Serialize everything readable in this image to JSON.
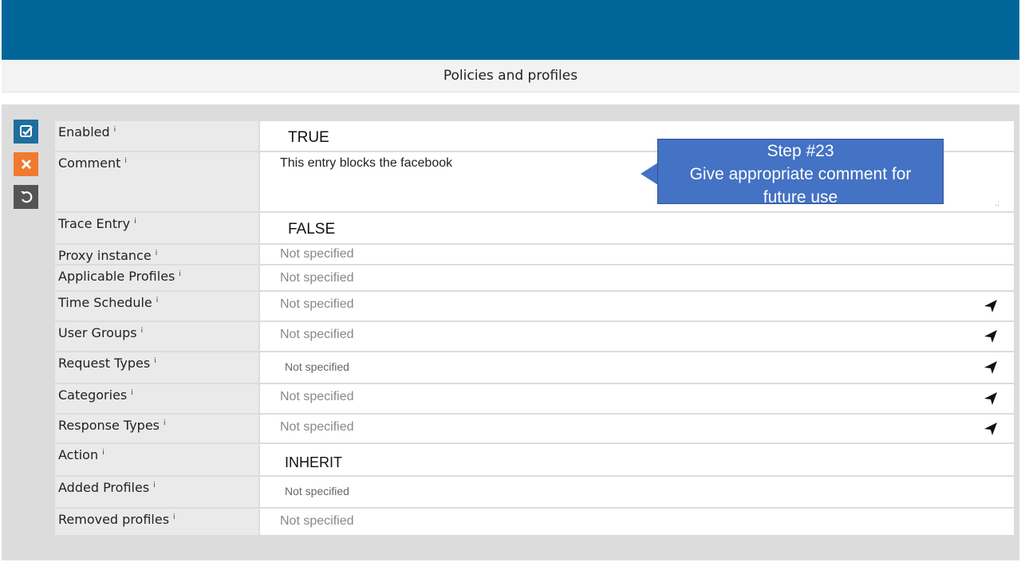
{
  "header": {
    "title": "Policies and profiles"
  },
  "actions": {
    "confirm_icon": "check-square-icon",
    "cancel_icon": "close-icon",
    "revert_icon": "undo-icon"
  },
  "fields": [
    {
      "label": "Enabled",
      "value": "TRUE"
    },
    {
      "label": "Comment",
      "value": "This entry blocks the facebook"
    },
    {
      "label": "Trace Entry",
      "value": "FALSE"
    },
    {
      "label": "Proxy instance",
      "value": "Not specified"
    },
    {
      "label": "Applicable Profiles",
      "value": "Not specified"
    },
    {
      "label": "Time Schedule",
      "value": "Not specified"
    },
    {
      "label": "User Groups",
      "value": "Not specified"
    },
    {
      "label": "Request Types",
      "value": "Not specified"
    },
    {
      "label": "Categories",
      "value": "Not specified"
    },
    {
      "label": "Response Types",
      "value": "Not specified"
    },
    {
      "label": "Action",
      "value": "INHERIT"
    },
    {
      "label": "Added Profiles",
      "value": "Not specified"
    },
    {
      "label": "Removed profiles",
      "value": "Not specified"
    }
  ],
  "info_glyph": "i",
  "callout": {
    "line1": "Step #23",
    "line2": "Give appropriate comment for",
    "line3": "future use"
  },
  "colors": {
    "header": "#006699",
    "confirm": "#1e6f9e",
    "cancel": "#f07a30",
    "callout": "#4472c4"
  }
}
